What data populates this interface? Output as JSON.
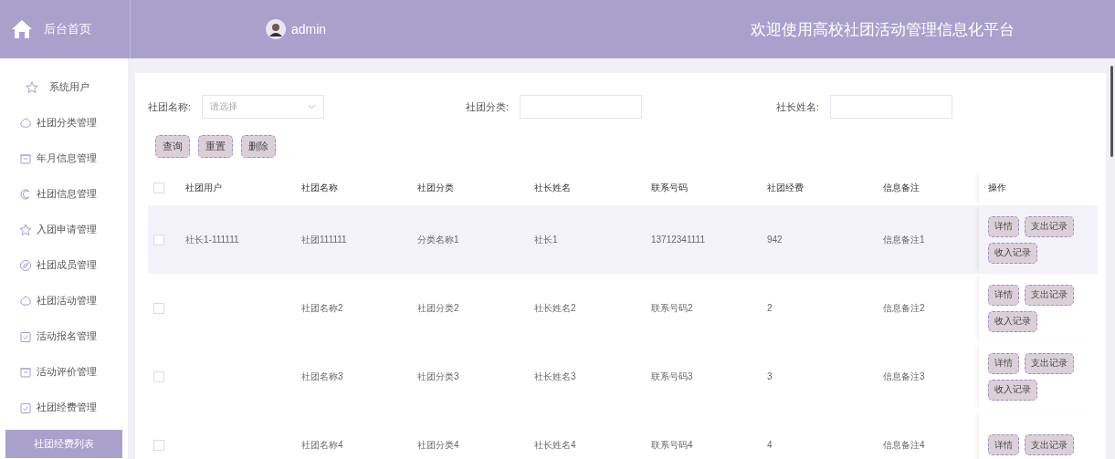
{
  "header": {
    "home_label": "后台首页",
    "user": "admin",
    "title": "欢迎使用高校社团活动管理信息化平台"
  },
  "sidebar": {
    "items": [
      {
        "label": "系统用户",
        "selected": false
      },
      {
        "label": "社团分类管理",
        "selected": false
      },
      {
        "label": "年月信息管理",
        "selected": false
      },
      {
        "label": "社团信息管理",
        "selected": false
      },
      {
        "label": "入团申请管理",
        "selected": false
      },
      {
        "label": "社团成员管理",
        "selected": false
      },
      {
        "label": "社团活动管理",
        "selected": false
      },
      {
        "label": "活动报名管理",
        "selected": false
      },
      {
        "label": "活动评价管理",
        "selected": false
      },
      {
        "label": "社团经费管理",
        "selected": false
      },
      {
        "label": "社团经费列表",
        "selected": true
      }
    ]
  },
  "filters": [
    {
      "label": "社团名称:",
      "kind": "select",
      "placeholder": "请选择"
    },
    {
      "label": "社团分类:",
      "kind": "text"
    },
    {
      "label": "社长姓名:",
      "kind": "text"
    }
  ],
  "buttons": [
    "查询",
    "重置",
    "删除"
  ],
  "table": {
    "header_checked": false,
    "columns": [
      "社团用户",
      "社团名称",
      "社团分类",
      "社长姓名",
      "联系号码",
      "社团经费",
      "信息备注",
      "操作"
    ],
    "rows": [
      {
        "checked": false,
        "highlighted": true,
        "cells": [
          "社长1-111111",
          "社团111111",
          "分类名称1",
          "社长1",
          "13712341111",
          "942",
          "信息备注1"
        ],
        "actions": [
          "详情",
          "支出记录",
          "收入记录"
        ]
      },
      {
        "checked": false,
        "highlighted": false,
        "cells": [
          "",
          "社团名称2",
          "社团分类2",
          "社长姓名2",
          "联系号码2",
          "2",
          "信息备注2"
        ],
        "actions": [
          "详情",
          "支出记录",
          "收入记录"
        ]
      },
      {
        "checked": false,
        "highlighted": false,
        "cells": [
          "",
          "社团名称3",
          "社团分类3",
          "社长姓名3",
          "联系号码3",
          "3",
          "信息备注3"
        ],
        "actions": [
          "详情",
          "支出记录",
          "收入记录"
        ]
      },
      {
        "checked": false,
        "highlighted": false,
        "cells": [
          "",
          "社团名称4",
          "社团分类4",
          "社长姓名4",
          "联系号码4",
          "4",
          "信息备注4"
        ],
        "actions": [
          "详情",
          "支出记录"
        ]
      }
    ]
  }
}
